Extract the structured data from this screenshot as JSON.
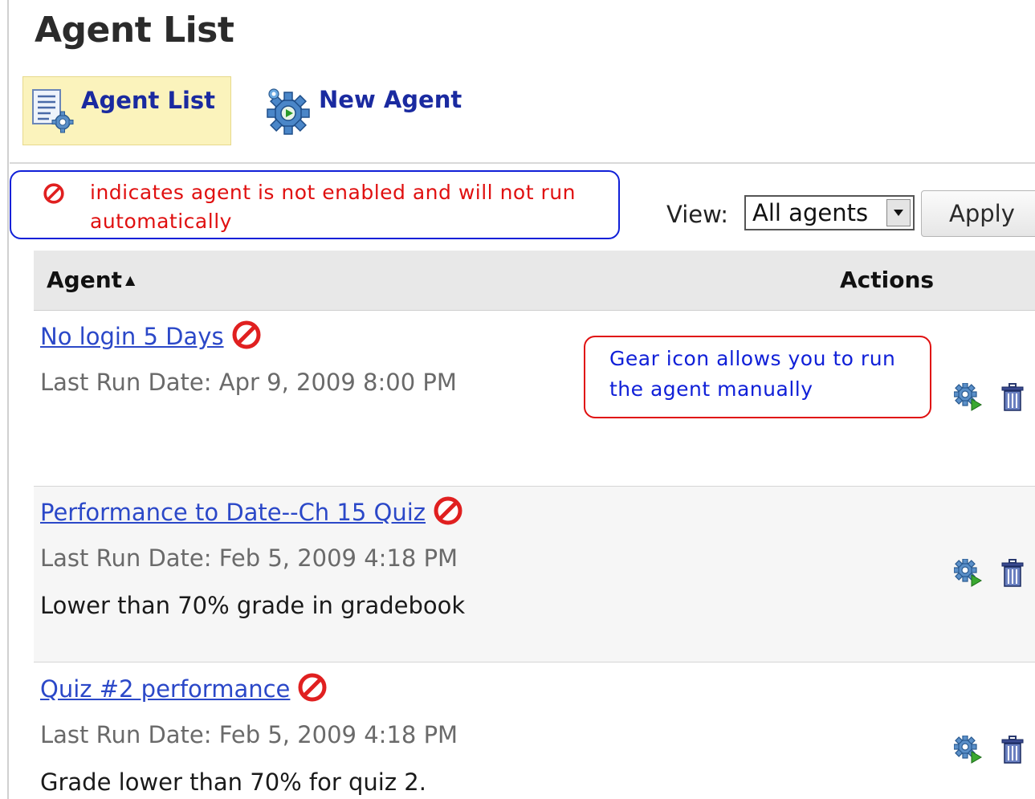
{
  "page": {
    "title": "Agent List"
  },
  "tabs": [
    {
      "label": "Agent List",
      "icon": "agent-list-icon",
      "active": true
    },
    {
      "label": "New Agent",
      "icon": "new-agent-gear-icon",
      "active": false
    }
  ],
  "legend": {
    "icon": "not-enabled-icon",
    "text": "indicates agent is not enabled and will not run automatically"
  },
  "view": {
    "label": "View:",
    "selected": "All agents",
    "apply_label": "Apply"
  },
  "table": {
    "headers": {
      "agent": "Agent",
      "sort_indicator": "▲",
      "actions": "Actions"
    },
    "rows": [
      {
        "name": "No login 5 Days",
        "enabled": false,
        "last_run": "Last Run Date: Apr 9, 2009 8:00 PM",
        "description": ""
      },
      {
        "name": "Performance to Date--Ch 15 Quiz",
        "enabled": false,
        "last_run": "Last Run Date: Feb 5, 2009 4:18 PM",
        "description": "Lower than 70% grade in gradebook"
      },
      {
        "name": "Quiz #2 performance",
        "enabled": false,
        "last_run": "Last Run Date: Feb 5, 2009 4:18 PM",
        "description": "Grade lower than 70% for quiz 2."
      }
    ]
  },
  "callout": {
    "text": "Gear icon allows you to run the agent manually"
  },
  "colors": {
    "link": "#2b48c8",
    "tab_label": "#1a2aa0",
    "active_tab_bg": "#fbf3bc",
    "legend_border": "#1020d8",
    "legend_text": "#e01010",
    "callout_border": "#e01010",
    "callout_text": "#1020d8",
    "disabled_icon": "#e02020"
  }
}
